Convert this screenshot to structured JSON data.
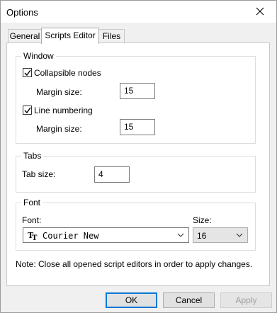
{
  "window": {
    "title": "Options",
    "close_icon": "close-icon"
  },
  "tabs": [
    {
      "label": "General",
      "active": false
    },
    {
      "label": "Scripts Editor",
      "active": true
    },
    {
      "label": "Files",
      "active": false
    }
  ],
  "window_group": {
    "legend": "Window",
    "collapsible": {
      "label": "Collapsible nodes",
      "checked": true
    },
    "collapsible_margin": {
      "label": "Margin size:",
      "value": "15"
    },
    "line_numbering": {
      "label": "Line numbering",
      "checked": true
    },
    "numbering_margin": {
      "label": "Margin size:",
      "value": "15"
    }
  },
  "tabs_group": {
    "legend": "Tabs",
    "tab_size": {
      "label": "Tab size:",
      "value": "4"
    }
  },
  "font_group": {
    "legend": "Font",
    "font_label": "Font:",
    "font_value": "Courier New",
    "font_icon": "truetype-font-icon",
    "size_label": "Size:",
    "size_value": "16"
  },
  "note": "Note: Close all opened script editors in order to apply changes.",
  "buttons": {
    "ok": "OK",
    "cancel": "Cancel",
    "apply": "Apply"
  },
  "colors": {
    "accent": "#0078d7",
    "background": "#f0f0f0",
    "panel": "#ffffff"
  }
}
